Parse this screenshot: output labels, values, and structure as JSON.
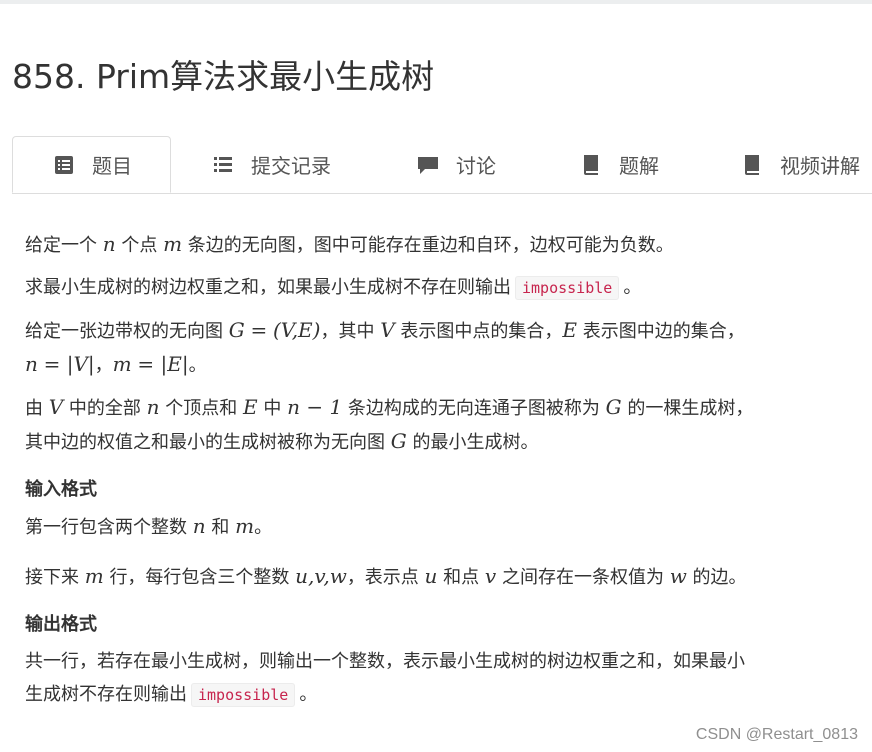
{
  "page": {
    "title": "858. Prim算法求最小生成树",
    "watermark": "CSDN @Restart_0813"
  },
  "tabs": [
    {
      "label": "题目",
      "icon": "list-icon",
      "active": true
    },
    {
      "label": "提交记录",
      "icon": "list-lines-icon",
      "active": false
    },
    {
      "label": "讨论",
      "icon": "comment-icon",
      "active": false
    },
    {
      "label": "题解",
      "icon": "book-icon",
      "active": false
    },
    {
      "label": "视频讲解",
      "icon": "book-icon",
      "active": false
    }
  ],
  "problem": {
    "p1": {
      "a": "给定一个",
      "n": "n",
      "b": "个点",
      "m": "m",
      "c": "条边的无向图，图中可能存在重边和自环，边权可能为负数。"
    },
    "p2": {
      "a": "求最小生成树的树边权重之和，如果最小生成树不存在则输出",
      "code": "impossible",
      "b": "。"
    },
    "p3": {
      "a": "给定一张边带权的无向图",
      "G": "G",
      "eq": "=",
      "paren": "(V,E)",
      "b": "，其中",
      "V": "V",
      "c": "表示图中点的集合，",
      "E": "E",
      "d": "表示图中边的集合，",
      "line2_n": "n",
      "line2_eq1": "= |V|",
      "line2_sep": "，",
      "line2_m": "m",
      "line2_eq2": "= |E|",
      "line2_end": "。"
    },
    "p4": {
      "a": "由",
      "V": "V",
      "b": "中的全部",
      "n": "n",
      "c": "个顶点和",
      "E": "E",
      "d": "中",
      "n1": "n − 1",
      "e": "条边构成的无向连通子图被称为",
      "G": "G",
      "f": "的一棵生成树，",
      "line2_a": "其中边的权值之和最小的生成树被称为无向图",
      "line2_G": "G",
      "line2_b": "的最小生成树。"
    },
    "input_heading": "输入格式",
    "in1": {
      "a": "第一行包含两个整数",
      "n": "n",
      "b": "和",
      "m": "m",
      "c": "。"
    },
    "in2": {
      "a": "接下来",
      "m": "m",
      "b": "行，每行包含三个整数",
      "uvw": "u,v,w",
      "c": "，表示点",
      "u": "u",
      "d": "和点",
      "v": "v",
      "e": "之间存在一条权值为",
      "w": "w",
      "f": "的边。"
    },
    "output_heading": "输出格式",
    "out1": {
      "line1": "共一行，若存在最小生成树，则输出一个整数，表示最小生成树的树边权重之和，如果最小",
      "a": "生成树不存在则输出",
      "code": "impossible",
      "b": "。"
    }
  }
}
